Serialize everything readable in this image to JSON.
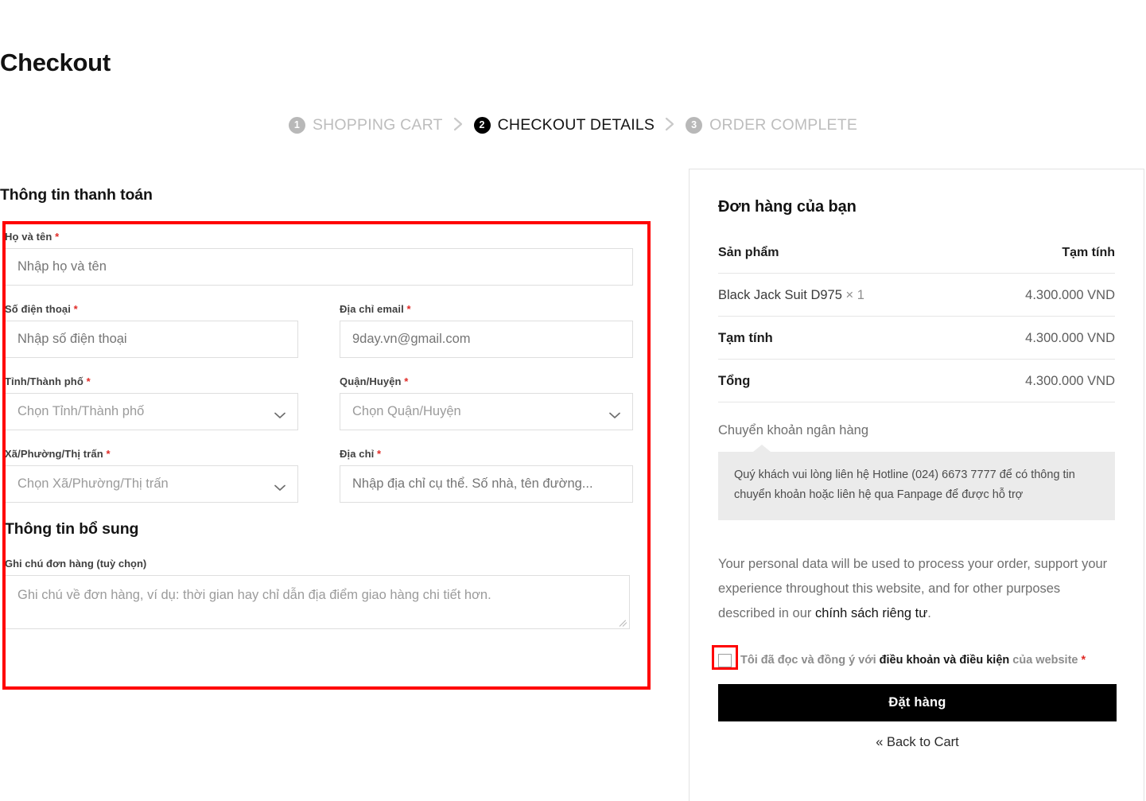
{
  "page": {
    "title": "Checkout"
  },
  "steps": {
    "separator": "❯",
    "items": [
      {
        "number": "1",
        "label": "SHOPPING CART",
        "state": "inactive"
      },
      {
        "number": "2",
        "label": "CHECKOUT DETAILS",
        "state": "active"
      },
      {
        "number": "3",
        "label": "ORDER COMPLETE",
        "state": "inactive"
      }
    ]
  },
  "billing": {
    "heading": "Thông tin thanh toán",
    "required_mark": "*",
    "fields": {
      "fullname": {
        "label": "Họ và tên",
        "placeholder": "Nhập họ và tên",
        "value": ""
      },
      "phone": {
        "label": "Số điện thoại",
        "placeholder": "Nhập số điện thoại",
        "value": ""
      },
      "email": {
        "label": "Địa chỉ email",
        "placeholder": "9day.vn@gmail.com",
        "value": ""
      },
      "province": {
        "label": "Tỉnh/Thành phố",
        "placeholder": "Chọn Tỉnh/Thành phố",
        "value": ""
      },
      "district": {
        "label": "Quận/Huyện",
        "placeholder": "Chọn Quận/Huyện",
        "value": ""
      },
      "ward": {
        "label": "Xã/Phường/Thị trấn",
        "placeholder": "Chọn Xã/Phường/Thị trấn",
        "value": ""
      },
      "address": {
        "label": "Địa chỉ",
        "placeholder": "Nhập địa chỉ cụ thể. Số nhà, tên đường...",
        "value": ""
      }
    }
  },
  "additional": {
    "heading": "Thông tin bổ sung",
    "note": {
      "label": "Ghi chú đơn hàng (tuỳ chọn)",
      "placeholder": "Ghi chú về đơn hàng, ví dụ: thời gian hay chỉ dẫn địa điểm giao hàng chi tiết hơn.",
      "value": ""
    }
  },
  "summary": {
    "title": "Đơn hàng của bạn",
    "header": {
      "product": "Sản phẩm",
      "subtotal": "Tạm tính"
    },
    "items": [
      {
        "name": "Black Jack Suit D975",
        "quantity": "× 1",
        "amount": "4.300.000 VND"
      }
    ],
    "totals": [
      {
        "label": "Tạm tính",
        "amount": "4.300.000 VND"
      },
      {
        "label": "Tổng",
        "amount": "4.300.000 VND"
      }
    ],
    "payment": {
      "method_label": "Chuyển khoản ngân hàng",
      "info": "Quý khách vui lòng liên hệ Hotline (024) 6673 7777 để có thông tin chuyển khoản hoặc liên hệ qua Fanpage để được hỗ trợ"
    },
    "privacy": {
      "text_before": "Your personal data will be used to process your order, support your experience throughout this website, and for other purposes described in our ",
      "link": "chính sách riêng tư",
      "text_after": "."
    },
    "terms": {
      "checked": false,
      "text_before": "Tôi đã đọc và đồng ý với ",
      "link": "điều khoản và điều kiện",
      "text_after": " của website ",
      "required_mark": "*"
    },
    "place_order_label": "Đặt hàng",
    "back_to_cart_label": "« Back to Cart"
  },
  "annotations": {
    "accent_color": "#ff0000"
  }
}
